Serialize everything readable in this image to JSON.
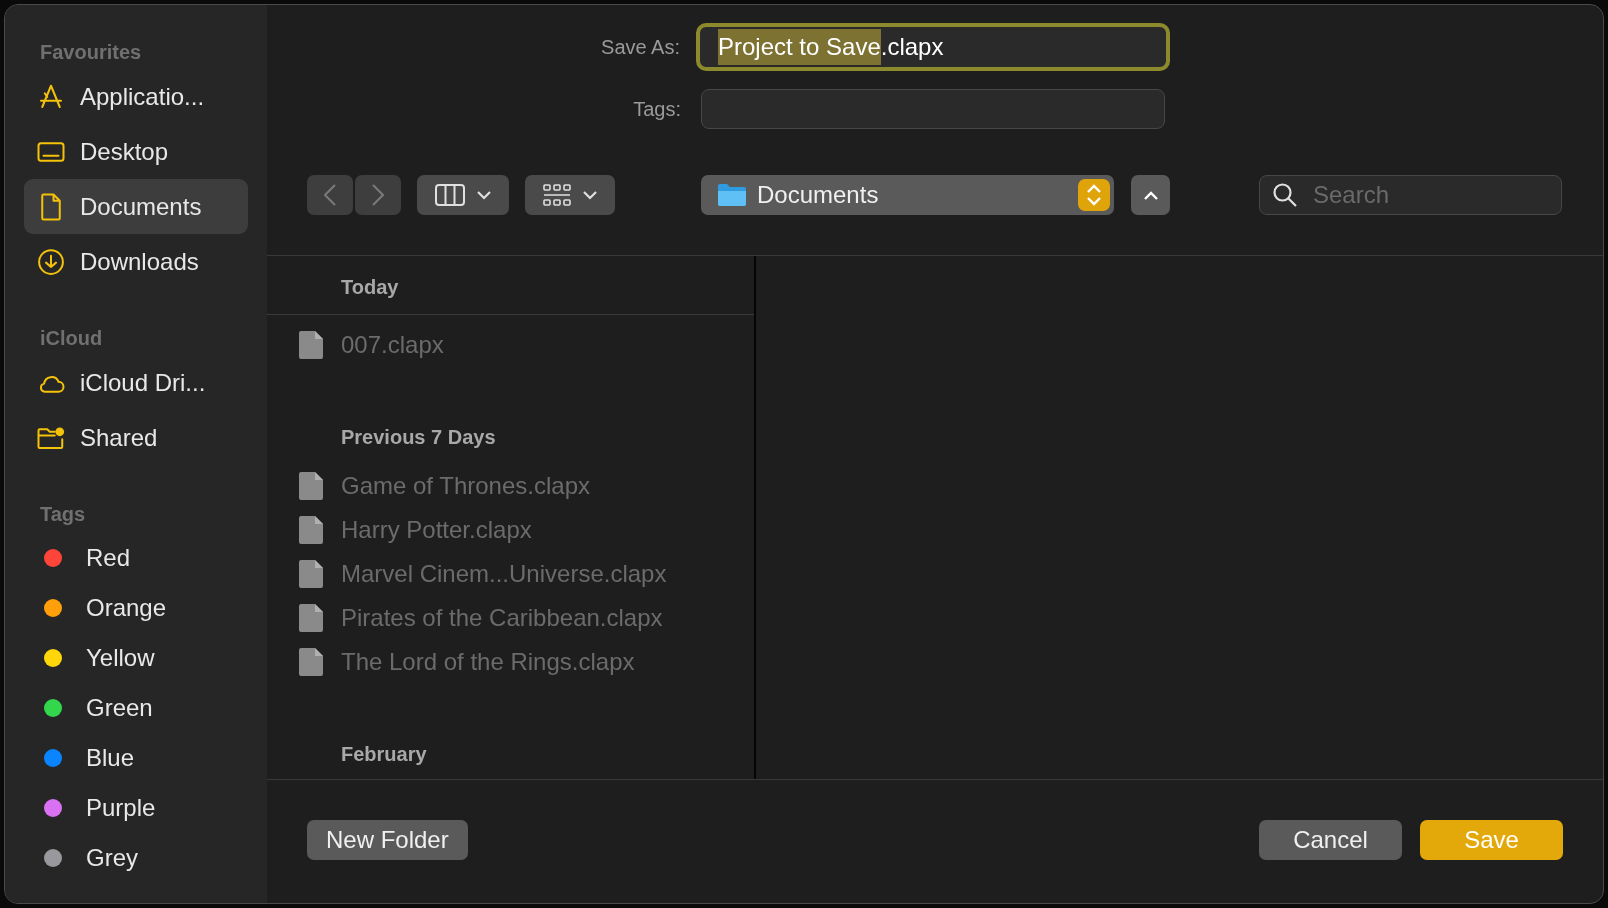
{
  "sidebar": {
    "sections": [
      {
        "title": "Favourites",
        "items": [
          {
            "label": "Applicatio...",
            "kind": "apps",
            "selected": false
          },
          {
            "label": "Desktop",
            "kind": "desktop",
            "selected": false
          },
          {
            "label": "Documents",
            "kind": "document",
            "selected": true
          },
          {
            "label": "Downloads",
            "kind": "download",
            "selected": false
          }
        ]
      },
      {
        "title": "iCloud",
        "items": [
          {
            "label": "iCloud Dri...",
            "kind": "cloud",
            "selected": false
          },
          {
            "label": "Shared",
            "kind": "shared",
            "selected": false
          }
        ]
      }
    ],
    "tags": {
      "title": "Tags",
      "items": [
        {
          "label": "Red",
          "color": "#ff453a"
        },
        {
          "label": "Orange",
          "color": "#ff9f0a"
        },
        {
          "label": "Yellow",
          "color": "#ffd60a"
        },
        {
          "label": "Green",
          "color": "#32d74b"
        },
        {
          "label": "Blue",
          "color": "#0a84ff"
        },
        {
          "label": "Purple",
          "color": "#da70f2"
        },
        {
          "label": "Grey",
          "color": "#98989d"
        }
      ]
    }
  },
  "save_as": {
    "label": "Save As:",
    "value_selected": "Project to Save",
    "value_rest": ".clapx"
  },
  "tags_field": {
    "label": "Tags:"
  },
  "toolbar": {
    "location": "Documents",
    "search": {
      "placeholder": "Search"
    }
  },
  "file_groups": [
    {
      "title": "Today",
      "files": [
        {
          "name": "007.clapx",
          "disabled": true
        }
      ]
    },
    {
      "title": "Previous 7 Days",
      "files": [
        {
          "name": "Game of Thrones.clapx",
          "disabled": true
        },
        {
          "name": "Harry Potter.clapx",
          "disabled": true
        },
        {
          "name": "Marvel Cinem...Universe.clapx",
          "disabled": true
        },
        {
          "name": "Pirates of the Caribbean.clapx",
          "disabled": true
        },
        {
          "name": "The Lord of the Rings.clapx",
          "disabled": true
        }
      ]
    },
    {
      "title": "February"
    }
  ],
  "buttons": {
    "new_folder": "New Folder",
    "cancel": "Cancel",
    "save": "Save"
  }
}
